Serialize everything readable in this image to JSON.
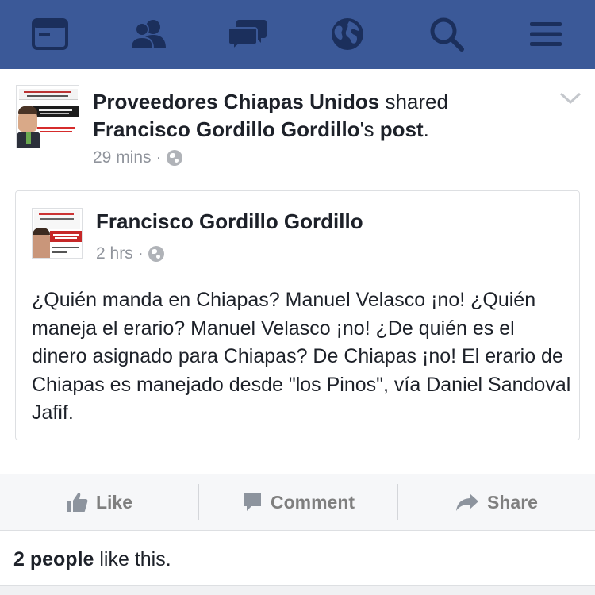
{
  "colors": {
    "topbar": "#3b5998",
    "nav_icon": "#1b2f5c",
    "meta_text": "#90949c",
    "action_text": "#7f7f7f"
  },
  "topbar": {
    "icons": [
      "news-feed-icon",
      "friends-icon",
      "messages-icon",
      "notifications-globe-icon",
      "search-icon",
      "menu-icon"
    ]
  },
  "post": {
    "header": {
      "page_name": "Proveedores Chiapas Unidos",
      "shared_word": " shared",
      "original_author": "Francisco Gordillo Gordillo",
      "possessive": "'s ",
      "post_word": "post",
      "period": "."
    },
    "timestamp": "29 mins",
    "separator": "·",
    "privacy_icon": "public-globe-icon",
    "shared": {
      "author": "Francisco Gordillo Gordillo",
      "timestamp": "2 hrs",
      "separator": "·",
      "text": "¿Quién manda en Chiapas? Manuel Velasco ¡no! ¿Quién maneja el erario? Manuel Velasco ¡no! ¿De quién es el dinero asignado para Chiapas? De Chiapas ¡no! El erario de Chiapas es manejado desde \"los Pinos\", vía Daniel Sandoval Jafif."
    }
  },
  "actions": {
    "like": "Like",
    "comment": "Comment",
    "share": "Share"
  },
  "likes": {
    "count_text": "2 people",
    "suffix": " like this."
  }
}
